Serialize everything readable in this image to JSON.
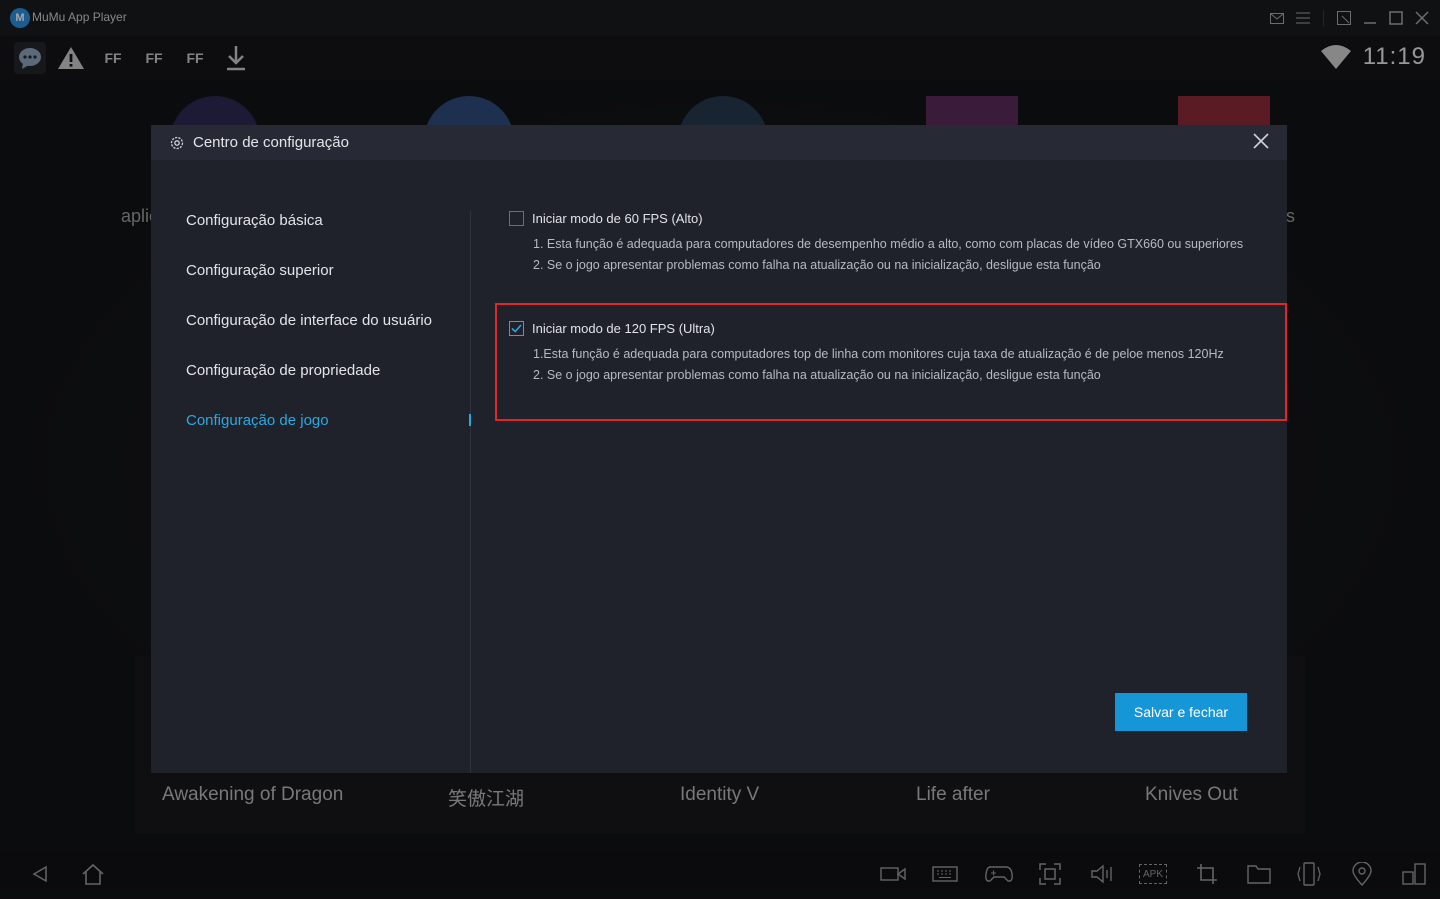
{
  "window": {
    "app_title": "MuMu App Player",
    "logo_letter": "M",
    "controls": [
      "mail-icon",
      "menu-icon",
      "resize-icon",
      "minimize-icon",
      "maximize-icon",
      "close-icon"
    ]
  },
  "statusbar": {
    "icons": [
      "chat-bubble-icon",
      "warning-icon",
      "ff-icon",
      "ff-icon",
      "ff-icon",
      "download-icon"
    ],
    "ff_label": "FF",
    "clock": "11:19"
  },
  "home": {
    "side_left": "aplic",
    "side_right": "s",
    "games": [
      "Awakening of Dragon",
      "笑傲江湖",
      "Identity V",
      "Life after",
      "Knives Out"
    ]
  },
  "navbar": {
    "icons": [
      "back-icon",
      "home-icon",
      "video-record-icon",
      "keyboard-icon",
      "gamepad-icon",
      "screenshot-icon",
      "volume-icon",
      "apk-install-icon",
      "crop-icon",
      "folder-icon",
      "shake-icon",
      "location-icon",
      "multi-window-icon"
    ],
    "apk_label": "APK"
  },
  "dialog": {
    "title": "Centro de configuração",
    "nav": [
      {
        "label": "Configuração básica",
        "active": false
      },
      {
        "label": "Configuração superior",
        "active": false
      },
      {
        "label": "Configuração de interface do usuário",
        "active": false
      },
      {
        "label": "Configuração de propriedade",
        "active": false
      },
      {
        "label": "Configuração de jogo",
        "active": true
      }
    ],
    "options": [
      {
        "checked": false,
        "title": "Iniciar modo de 60 FPS (Alto)",
        "lines": [
          "1. Esta função é adequada para computadores de desempenho médio a alto, como com placas de vídeo GTX660 ou superiores",
          "2. Se o jogo apresentar problemas como falha na atualização ou na inicialização, desligue esta função"
        ]
      },
      {
        "checked": true,
        "title": "Iniciar modo de 120 FPS (Ultra)",
        "lines": [
          "1.Esta função é adequada para computadores top de linha com monitores cuja taxa de atualização é de peloe menos 120Hz",
          "2. Se o jogo apresentar problemas como falha na atualização ou na inicialização, desligue esta função"
        ]
      }
    ],
    "save_label": "Salvar e fechar"
  },
  "colors": {
    "accent": "#2aa8e0",
    "button": "#1596d6",
    "highlight_border": "#e0252b",
    "dialog_bg": "#1f222b"
  }
}
